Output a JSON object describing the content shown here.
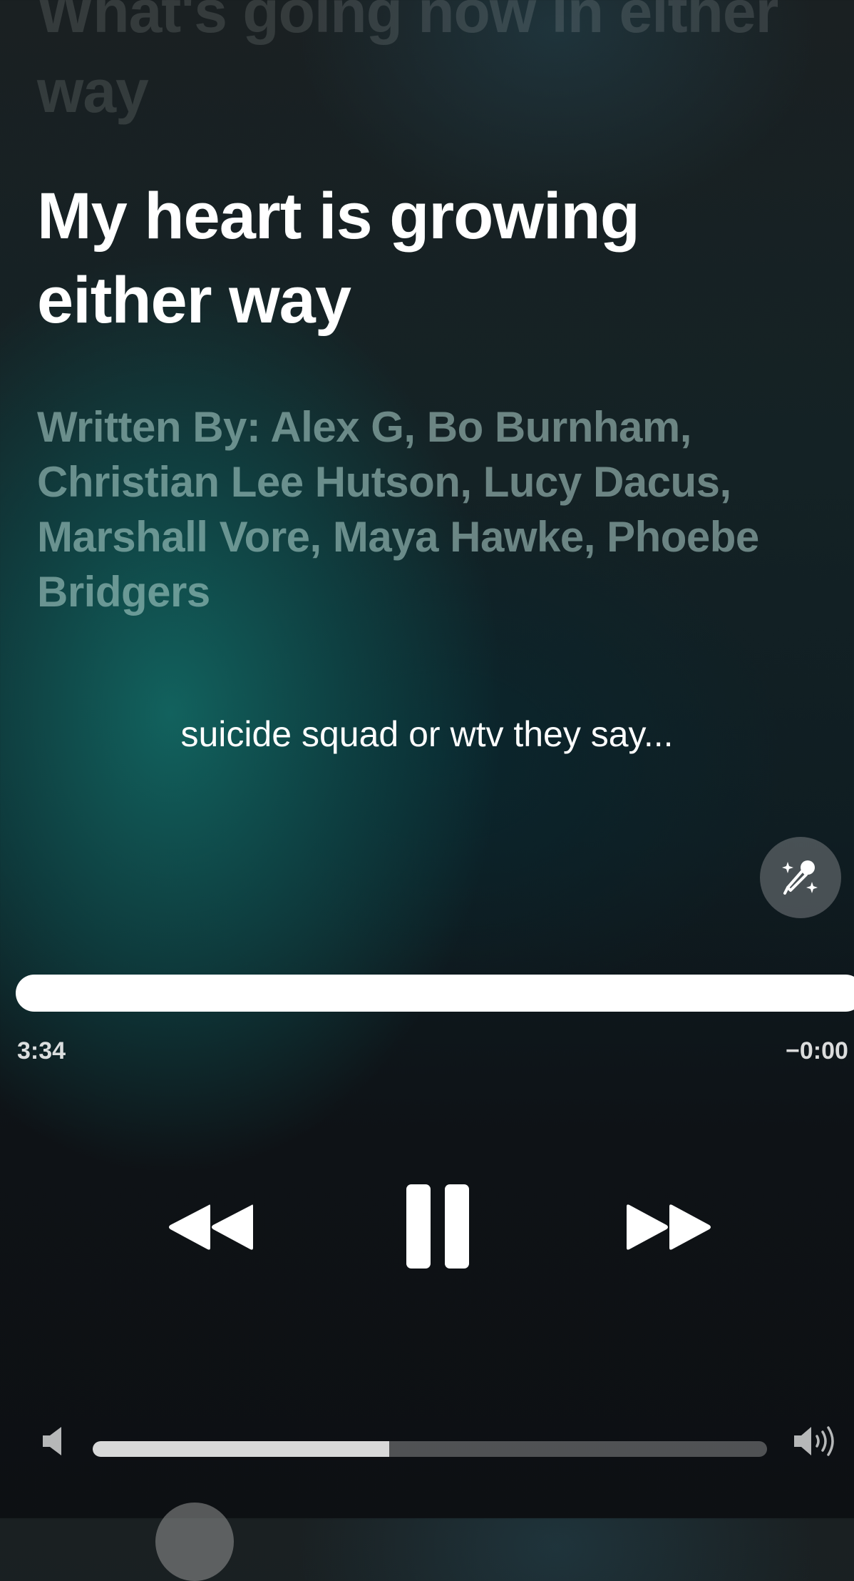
{
  "lyrics": {
    "previous_line": "What's going now in either way",
    "current_line": "My heart is growing either way",
    "credits": "Written By: Alex G, Bo Burnham, Christian Lee Hutson, Lucy Dacus, Marshall Vore, Maya Hawke, Phoebe Bridgers"
  },
  "caption": {
    "text": "suicide squad or wtv they say..."
  },
  "lyrics_mode_button": {
    "icon": "microphone-sparkle-icon"
  },
  "progress": {
    "elapsed": "3:34",
    "remaining": "−0:00",
    "fraction": 1.0
  },
  "controls": {
    "rewind_icon": "rewind-icon",
    "pause_icon": "pause-icon",
    "forward_icon": "fast-forward-icon"
  },
  "volume": {
    "level": 0.44,
    "low_icon": "speaker-low-icon",
    "high_icon": "speaker-high-icon"
  },
  "colors": {
    "accent_teal": "#126964",
    "background": "#0d1013",
    "text": "#ffffff"
  }
}
